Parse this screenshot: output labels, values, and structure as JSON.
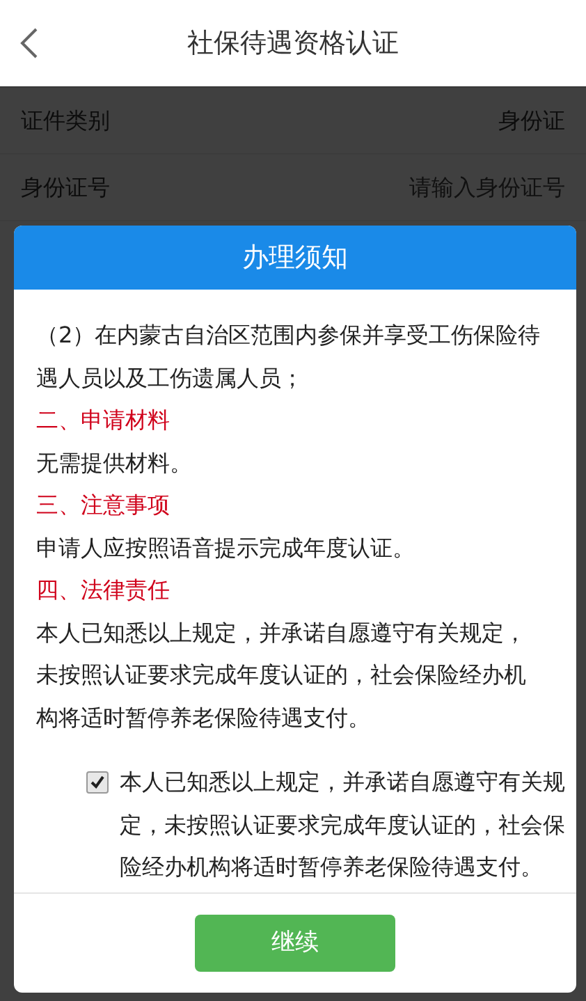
{
  "header": {
    "title": "社保待遇资格认证"
  },
  "form": [
    {
      "kind": "value",
      "label": "证件类别",
      "value": "身份证"
    },
    {
      "kind": "input",
      "label": "身份证号",
      "placeholder": "请输入身份证号"
    }
  ],
  "dialog": {
    "title": "办理须知",
    "content": [
      {
        "kind": "text",
        "text": "（2）在内蒙古自治区范围内参保并享受工伤保险待遇人员以及工伤遗属人员；"
      },
      {
        "kind": "heading",
        "text": "二、申请材料"
      },
      {
        "kind": "text",
        "text": "无需提供材料。"
      },
      {
        "kind": "heading",
        "text": "三、注意事项"
      },
      {
        "kind": "text",
        "text": "申请人应按照语音提示完成年度认证。"
      },
      {
        "kind": "heading",
        "text": "四、法律责任"
      },
      {
        "kind": "text",
        "text": "本人已知悉以上规定，并承诺自愿遵守有关规定，未按照认证要求完成年度认证的，社会保险经办机构将适时暂停养老保险待遇支付。"
      }
    ],
    "agreement": {
      "checked": true,
      "text": "本人已知悉以上规定，并承诺自愿遵守有关规定，未按照认证要求完成年度认证的，社会保险经办机构将适时暂停养老保险待遇支付。"
    },
    "button": "继续"
  }
}
